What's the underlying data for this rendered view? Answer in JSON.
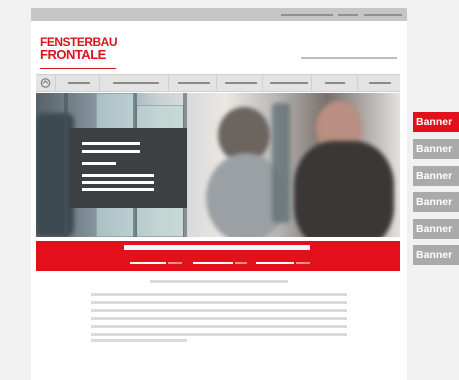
{
  "logo": {
    "line1": "FENSTERBAU",
    "line2": "FRONTALE"
  },
  "colors": {
    "brand_red": "#e3101c",
    "banner_active": "#e3101c",
    "banner_inactive": "#aaaaaa",
    "overlay": "#3f4043"
  },
  "banners": [
    {
      "label": "Banner",
      "active": true
    },
    {
      "label": "Banner",
      "active": false
    },
    {
      "label": "Banner",
      "active": false
    },
    {
      "label": "Banner",
      "active": false
    },
    {
      "label": "Banner",
      "active": false
    },
    {
      "label": "Banner",
      "active": false
    }
  ],
  "icons": {
    "home": "home-icon"
  }
}
